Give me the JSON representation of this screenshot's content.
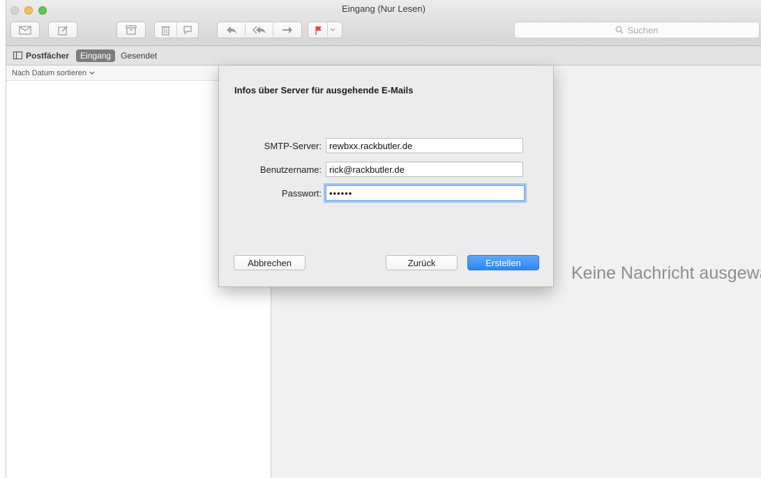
{
  "window": {
    "title": "Eingang (Nur Lesen)"
  },
  "toolbar": {
    "search_placeholder": "Suchen"
  },
  "favorites": {
    "mailboxes": "Postfächer",
    "inbox": "Eingang",
    "sent": "Gesendet"
  },
  "list": {
    "sort_label": "Nach Datum sortieren"
  },
  "viewer": {
    "empty_message": "Keine Nachricht ausgewählt"
  },
  "dialog": {
    "title": "Infos über Server für ausgehende E-Mails",
    "smtp_label": "SMTP-Server:",
    "smtp_value": "rewbxx.rackbutler.de",
    "user_label": "Benutzername:",
    "user_value": "rick@rackbutler.de",
    "password_label": "Passwort:",
    "password_value": "••••••",
    "cancel": "Abbrechen",
    "back": "Zurück",
    "create": "Erstellen"
  },
  "colors": {
    "accent": "#2e86f5",
    "flag": "#e84a4a"
  },
  "icons": [
    "envelope-icon",
    "compose-icon",
    "archive-icon",
    "trash-icon",
    "junk-icon",
    "reply-icon",
    "reply-all-icon",
    "forward-icon",
    "flag-icon",
    "chevron-down-icon",
    "search-icon",
    "mailbox-sidebar-icon"
  ]
}
